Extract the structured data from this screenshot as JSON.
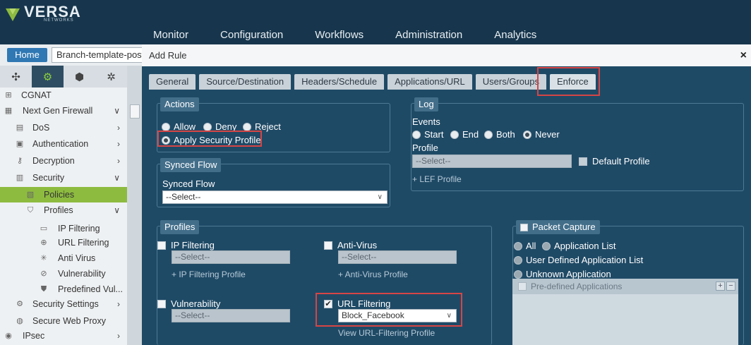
{
  "brand": {
    "name": "VERSA",
    "sub": "NETWORKS",
    "accent": "#8dbb3f"
  },
  "topnav": [
    "Monitor",
    "Configuration",
    "Workflows",
    "Administration",
    "Analytics"
  ],
  "home": {
    "label": "Home",
    "breadcrumb": "Branch-template-post"
  },
  "sidebar": {
    "tab_icons": [
      "network-icon",
      "gear-icon",
      "cube-icon",
      "settings-cog-icon"
    ],
    "items": [
      {
        "label": "CGNAT",
        "icon": "cgnat-icon"
      },
      {
        "label": "Next Gen Firewall",
        "icon": "firewall-icon"
      },
      {
        "label": "DoS",
        "icon": "dos-icon"
      },
      {
        "label": "Authentication",
        "icon": "authentication-icon"
      },
      {
        "label": "Decryption",
        "icon": "decryption-icon"
      },
      {
        "label": "Security",
        "icon": "security-icon"
      },
      {
        "label": "Policies",
        "icon": "policies-icon"
      },
      {
        "label": "Profiles",
        "icon": "profiles-icon"
      },
      {
        "label": "IP Filtering",
        "icon": "ip-filtering-icon"
      },
      {
        "label": "URL Filtering",
        "icon": "url-filtering-icon"
      },
      {
        "label": "Anti Virus",
        "icon": "anti-virus-icon"
      },
      {
        "label": "Vulnerability",
        "icon": "vulnerability-icon"
      },
      {
        "label": "Predefined Vul...",
        "icon": "predefined-vulnerability-icon"
      },
      {
        "label": "Security Settings",
        "icon": "security-settings-icon"
      },
      {
        "label": "Secure Web Proxy",
        "icon": "web-proxy-icon"
      },
      {
        "label": "IPsec",
        "icon": "ipsec-icon"
      }
    ]
  },
  "modal": {
    "title": "Add Rule",
    "close": "×",
    "tabs": [
      "General",
      "Source/Destination",
      "Headers/Schedule",
      "Applications/URL",
      "Users/Groups",
      "Enforce"
    ],
    "actions": {
      "title": "Actions",
      "options": [
        "Allow",
        "Deny",
        "Reject",
        "Apply Security Profile"
      ],
      "selected": "Apply Security Profile"
    },
    "log": {
      "title": "Log",
      "events_label": "Events",
      "events": [
        "Start",
        "End",
        "Both",
        "Never"
      ],
      "selected": "Never",
      "profile_label": "Profile",
      "profile_placeholder": "--Select--",
      "default_profile": "Default Profile",
      "add_link": "+ LEF Profile"
    },
    "synced_flow": {
      "title": "Synced Flow",
      "label": "Synced Flow",
      "value": "--Select--"
    },
    "profiles": {
      "title": "Profiles",
      "ip_filtering": {
        "label": "IP Filtering",
        "value": "--Select--",
        "link": "+ IP Filtering Profile"
      },
      "anti_virus": {
        "label": "Anti-Virus",
        "value": "--Select--",
        "link": "+ Anti-Virus Profile"
      },
      "vulnerability": {
        "label": "Vulnerability",
        "value": "--Select--"
      },
      "url_filtering": {
        "label": "URL Filtering",
        "value": "Block_Facebook",
        "link": "View URL-Filtering Profile",
        "checkmark": "✔"
      }
    },
    "packet_capture": {
      "title": "Packet Capture",
      "options": [
        "All",
        "Application List",
        "User Defined Application List",
        "Unknown Application"
      ],
      "list_header": "Pre-defined Applications",
      "add": "+",
      "remove": "−"
    }
  },
  "highlight_color": "#d64545"
}
